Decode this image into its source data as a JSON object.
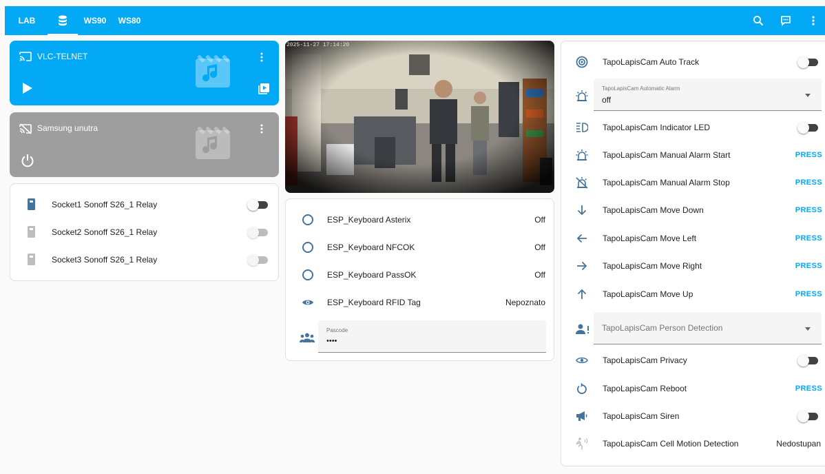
{
  "header": {
    "tabs": [
      {
        "label": "LAB"
      },
      {
        "label": "",
        "icon": "database-icon"
      },
      {
        "label": "WS90"
      },
      {
        "label": "WS80"
      }
    ],
    "active_tab": 1,
    "actions": [
      "search-icon",
      "chat-icon",
      "more-vert-icon"
    ]
  },
  "colors": {
    "accent": "#03a9f4",
    "icon": "#44739e",
    "media_off": "#9e9e9e",
    "toggle_on": "#424242"
  },
  "media": [
    {
      "title": "VLC-TELNET",
      "state": "playing",
      "icon": "cast-icon",
      "controls": [
        "play-icon",
        "playlist-icon"
      ]
    },
    {
      "title": "Samsung unutra",
      "state": "off",
      "icon": "cast-off-icon",
      "controls": [
        "power-icon"
      ]
    }
  ],
  "sockets": [
    {
      "label": "Socket1 Sonoff S26_1 Relay",
      "state": "on"
    },
    {
      "label": "Socket2 Sonoff S26_1 Relay",
      "state": "unavailable"
    },
    {
      "label": "Socket3 Sonoff S26_1 Relay",
      "state": "unavailable"
    }
  ],
  "camera": {
    "timestamp": "2025-11-27 17:14:20"
  },
  "keyboard": {
    "rows": [
      {
        "label": "ESP_Keyboard Asterix",
        "value": "Off",
        "icon": "circle-outline-icon"
      },
      {
        "label": "ESP_Keyboard NFCOK",
        "value": "Off",
        "icon": "circle-outline-icon"
      },
      {
        "label": "ESP_Keyboard PassOK",
        "value": "Off",
        "icon": "circle-outline-icon"
      },
      {
        "label": "ESP_Keyboard RFID Tag",
        "value": "Nepoznato",
        "icon": "eye-icon"
      }
    ],
    "pascode": {
      "label": "Pascode",
      "value": "••••",
      "icon": "account-group-icon"
    }
  },
  "tapo": {
    "auto_track": {
      "label": "TapoLapisCam Auto Track"
    },
    "alarm_select": {
      "small": "TapoLapisCam Automatic Alarm",
      "value": "off"
    },
    "indicator_led": {
      "label": "TapoLapisCam Indicator LED"
    },
    "alarm_start": {
      "label": "TapoLapisCam Manual Alarm Start",
      "action": "PRESS"
    },
    "alarm_stop": {
      "label": "TapoLapisCam Manual Alarm Stop",
      "action": "PRESS"
    },
    "move_down": {
      "label": "TapoLapisCam Move Down",
      "action": "PRESS"
    },
    "move_left": {
      "label": "TapoLapisCam Move Left",
      "action": "PRESS"
    },
    "move_right": {
      "label": "TapoLapisCam Move Right",
      "action": "PRESS"
    },
    "move_up": {
      "label": "TapoLapisCam Move Up",
      "action": "PRESS"
    },
    "person_select": {
      "placeholder": "TapoLapisCam Person Detection"
    },
    "privacy": {
      "label": "TapoLapisCam Privacy"
    },
    "reboot": {
      "label": "TapoLapisCam Reboot",
      "action": "PRESS"
    },
    "siren": {
      "label": "TapoLapisCam Siren"
    },
    "cell_motion": {
      "label": "TapoLapisCam Cell Motion Detection",
      "value": "Nedostupan"
    }
  }
}
